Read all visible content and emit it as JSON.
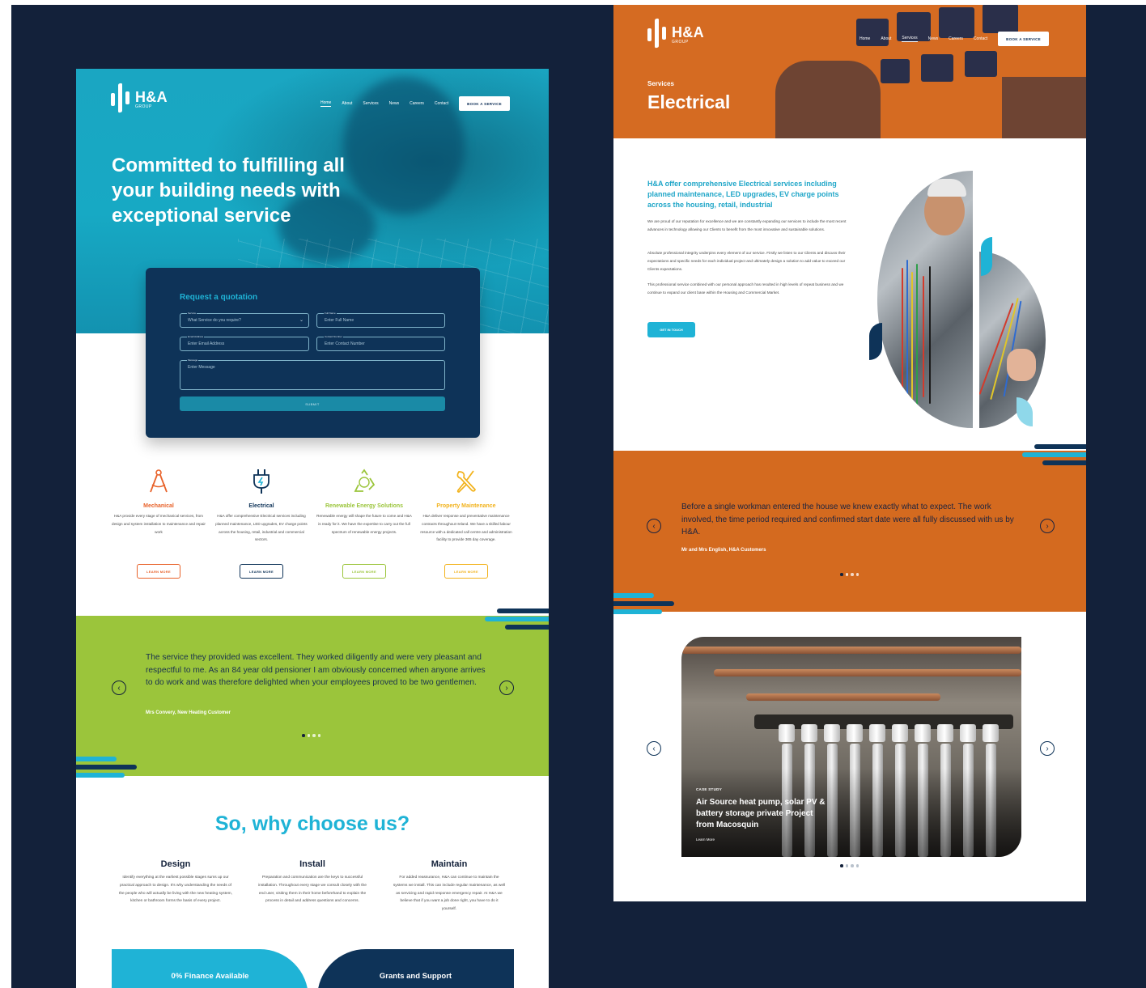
{
  "left_page": {
    "logo": {
      "name": "H&A",
      "sub": "GROUP"
    },
    "nav": [
      "Home",
      "About",
      "Services",
      "News",
      "Careers",
      "Contact"
    ],
    "book_button": "BOOK A SERVICE",
    "headline": "Committed to fulfilling all your building needs with exceptional service",
    "quote_form": {
      "title": "Request a quotation",
      "service": {
        "label": "Service",
        "placeholder": "What Service do you require?"
      },
      "full_name": {
        "label": "Full Name",
        "placeholder": "Enter Full Name"
      },
      "email": {
        "label": "Email Address",
        "placeholder": "Enter Email Address"
      },
      "contact": {
        "label": "Contact Number",
        "placeholder": "Enter Contact Number"
      },
      "message": {
        "label": "Message",
        "placeholder": "Enter Message"
      },
      "submit": "SUBMIT"
    },
    "services": [
      {
        "name": "Mechanical",
        "color": "#e8622a",
        "desc": "H&A provide every stage of mechanical services, from design and system installation to maintenance and repair work",
        "button": "LEARN MORE",
        "icon": "compass-icon"
      },
      {
        "name": "Electrical",
        "color": "#0e3358",
        "desc": "H&A offer comprehensive Electrical services including planned maintenance, LED upgrades, EV charge points across the housing, retail, industrial and commercial sectors.",
        "button": "LEARN MORE",
        "icon": "plug-icon"
      },
      {
        "name": "Renewable Energy Solutions",
        "color": "#9bc53b",
        "desc": "Renewable energy will shape the future to come and H&A is ready for it. We have the expertise to carry out the full spectrum of renewable energy projects.",
        "button": "LEARN MORE",
        "icon": "recycle-icon"
      },
      {
        "name": "Property Maintenance",
        "color": "#f2b21b",
        "desc": "H&A deliver response and preventative maintenance contracts throughout Ireland. We have a skilled labour resource with a dedicated call centre and administration facility to provide 365 day coverage.",
        "button": "LEARN MORE",
        "icon": "tools-icon"
      }
    ],
    "testimonial": {
      "quote": "The service they provided was excellent. They worked diligently and were very pleasant and respectful to me. As an 84 year old pensioner I am obviously concerned when anyone arrives to do work and was therefore delighted when your employees proved to be two gentlemen.",
      "author": "Mrs Convery, New Heating Customer"
    },
    "why": {
      "title": "So, why choose us?",
      "columns": [
        {
          "heading": "Design",
          "text": "Identify everything at the earliest possible stages sums up our practical approach to design. It's why understanding the needs of the people who will actually be living with the new heating system, kitchen or bathroom forms the basis of every project."
        },
        {
          "heading": "Install",
          "text": "Preparation and communication are the keys to successful installation. Throughout every stage we consult closely with the end user, visiting them in their home beforehand to explain the process in detail and address questions and concerns."
        },
        {
          "heading": "Maintain",
          "text": "For added reassurance, H&A can continue to maintain the systems we install. This can include regular maintenance, as well as servicing and rapid response emergency repair. At H&A we believe that if you want a job done right, you have to do it yourself."
        }
      ]
    },
    "finance": "0% Finance Available",
    "grants": "Grants and Support"
  },
  "right_page": {
    "logo": {
      "name": "H&A",
      "sub": "GROUP"
    },
    "nav": [
      "Home",
      "About",
      "Services",
      "News",
      "Careers",
      "Contact"
    ],
    "book_button": "BOOK A SERVICE",
    "section": "Services",
    "title": "Electrical",
    "lead": "H&A offer comprehensive Electrical services including planned maintenance, LED upgrades, EV charge points across the housing, retail, industrial",
    "paragraphs": [
      "We are proud of our reputation for excellence and we are constantly expanding our services to include the most recent advances in technology allowing our Clients to benefit from the most innovative and sustainable solutions.",
      "Absolute professional integrity underpins every element of our service. Firstly we listen to our Clients and discuss their expectations and specific needs for each individual project and ultimately design a solution to add value to exceed our Clients expectations.",
      "This professional service combined with our personal approach has resulted in high levels of repeat business and we continue to expand our client base within the Housing and Commercial Market."
    ],
    "cta": "GET IN TOUCH",
    "testimonial": {
      "quote": "Before a single workman entered the house we knew exactly what to expect. The work involved, the time period required and confirmed start date were all fully discussed with us by H&A.",
      "author": "Mr and Mrs English, H&A Customers"
    },
    "case_study": {
      "tag": "CASE STUDY",
      "title": "Air Source heat pump, solar PV & battery storage private Project from Macosquin",
      "link": "Learn More"
    }
  },
  "colors": {
    "background": "#13213a",
    "cyan": "#1fb3d6",
    "navy": "#0e3358",
    "green": "#9bc53b",
    "orange": "#d46a1f"
  }
}
